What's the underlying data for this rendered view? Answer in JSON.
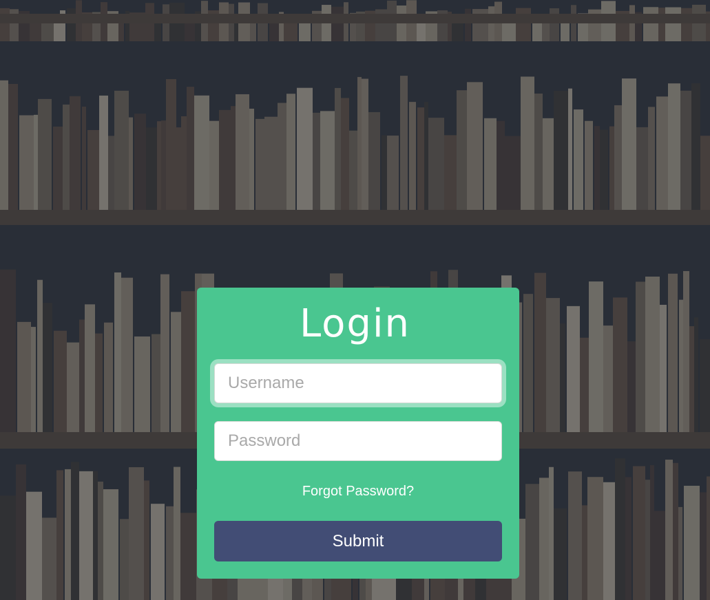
{
  "login": {
    "title": "Login",
    "username_placeholder": "Username",
    "password_placeholder": "Password",
    "forgot_label": "Forgot Password?",
    "submit_label": "Submit"
  },
  "colors": {
    "card": "#4ac690",
    "submit": "#424d75",
    "text": "#ffffff"
  }
}
